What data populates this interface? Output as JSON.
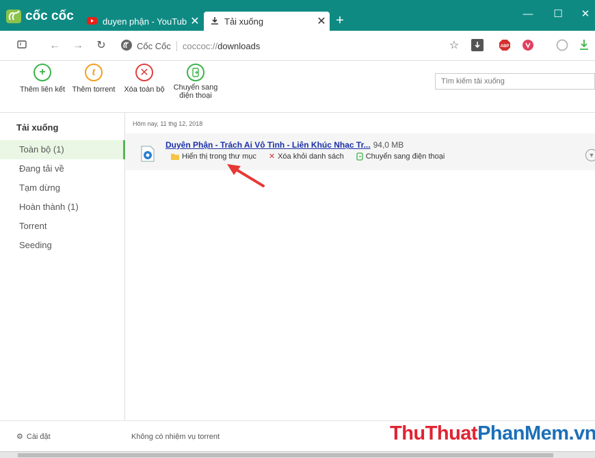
{
  "browser": {
    "brand": "cốc cốc",
    "tabs": [
      {
        "title": "duyen phận - YouTub",
        "icon": "youtube-icon",
        "active": false
      },
      {
        "title": "Tải xuống",
        "icon": "download-icon",
        "active": true
      }
    ],
    "new_tab": "+",
    "window_controls": {
      "minimize": "—",
      "maximize": "☐",
      "close": "✕"
    }
  },
  "addressbar": {
    "site_label": "Cốc Cốc",
    "url_scheme": "coccoc://",
    "url_path": "downloads"
  },
  "actions": {
    "add_link": "Thêm liên kết",
    "add_torrent": "Thêm torrent",
    "delete_all": "Xóa toàn bộ",
    "send_phone": "Chuyển sang điện thoại",
    "search_placeholder": "Tìm kiếm tải xuống"
  },
  "sidebar": {
    "title": "Tải xuống",
    "items": [
      {
        "label": "Toàn bộ (1)",
        "selected": true
      },
      {
        "label": "Đang tải về"
      },
      {
        "label": "Tạm dừng"
      },
      {
        "label": "Hoàn thành (1)"
      },
      {
        "label": "Torrent"
      },
      {
        "label": "Seeding"
      }
    ]
  },
  "downloads": {
    "date_header": "Hôm nay, 11 thg 12, 2018",
    "items": [
      {
        "title": "Duyên Phận - Trách Ai Vô Tình - Liên Khúc Nhạc Tr...",
        "size": "94,0 MB",
        "show_in_folder": "Hiển thị trong thư mục",
        "remove": "Xóa khỏi danh sách",
        "send_phone": "Chuyển sang điện thoại"
      }
    ]
  },
  "footer": {
    "settings": "Cài đặt",
    "status": "Không có nhiệm vụ torrent",
    "watermark_part1": "ThuThuat",
    "watermark_part2": "PhanMem.vn"
  },
  "colors": {
    "titlebar": "#0e8a83",
    "add_green": "#3ab34a",
    "torrent_orange": "#f0a020",
    "delete_red": "#e04040",
    "link_blue": "#1a2fa8"
  }
}
